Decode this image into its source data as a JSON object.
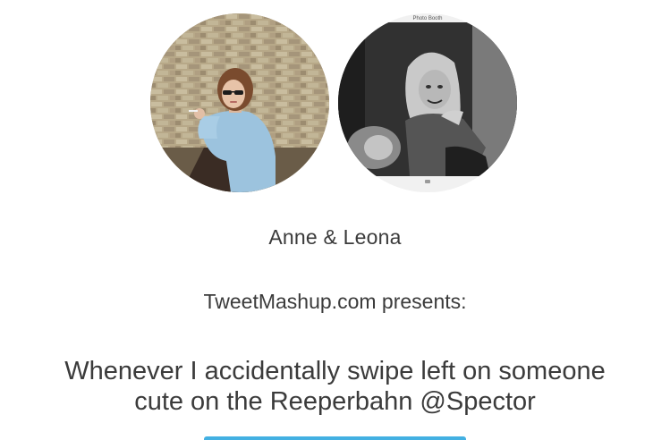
{
  "profile": {
    "names": "Anne & Leona",
    "left_avatar_icon": "photo-avatar-icon",
    "right_avatar_icon": "photo-booth-avatar-icon",
    "photo_booth_label": "Photo Booth"
  },
  "header": {
    "presents": "TweetMashup.com presents:"
  },
  "tweet": {
    "line1": "Whenever I accidentally swipe left on someone",
    "line2": "cute on the Reeperbahn @Spector"
  },
  "colors": {
    "text": "#3b3b3b",
    "accent": "#43b0e2",
    "background": "#ffffff"
  }
}
